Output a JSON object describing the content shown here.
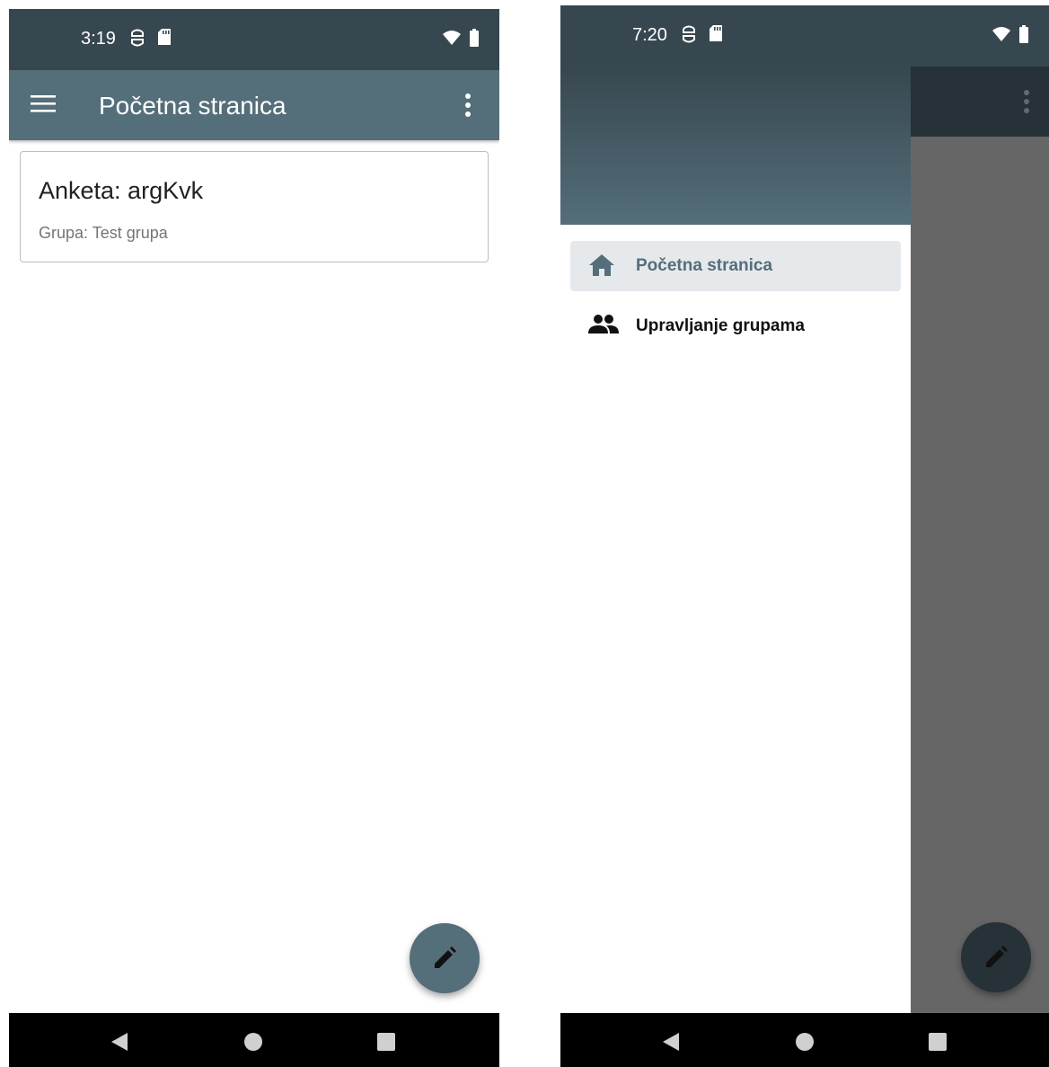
{
  "colors": {
    "primary": "#546e7a",
    "primary_dark": "#37474f",
    "scrim": "#666666",
    "nav_bar": "#000000"
  },
  "left_screen": {
    "status_bar": {
      "time": "3:19",
      "icons": [
        "sim-icon",
        "sd-card-icon",
        "wifi-icon",
        "battery-icon"
      ]
    },
    "app_bar": {
      "title": "Početna stranica",
      "icons": [
        "menu-icon",
        "more-vert-icon"
      ]
    },
    "survey_card": {
      "title": "Anketa: argKvk",
      "group": "Grupa: Test grupa"
    },
    "fab": {
      "icon": "edit-icon"
    },
    "nav_bar": {
      "icons": [
        "back-icon",
        "home-icon",
        "recents-icon"
      ]
    }
  },
  "right_screen": {
    "status_bar": {
      "time": "7:20",
      "icons": [
        "sim-icon",
        "sd-card-icon",
        "wifi-icon",
        "battery-icon"
      ]
    },
    "drawer": {
      "items": [
        {
          "label": "Početna stranica",
          "icon": "home-icon",
          "selected": true
        },
        {
          "label": "Upravljanje grupama",
          "icon": "group-icon",
          "selected": false
        }
      ]
    },
    "fab": {
      "icon": "edit-icon"
    },
    "nav_bar": {
      "icons": [
        "back-icon",
        "home-icon",
        "recents-icon"
      ]
    }
  }
}
